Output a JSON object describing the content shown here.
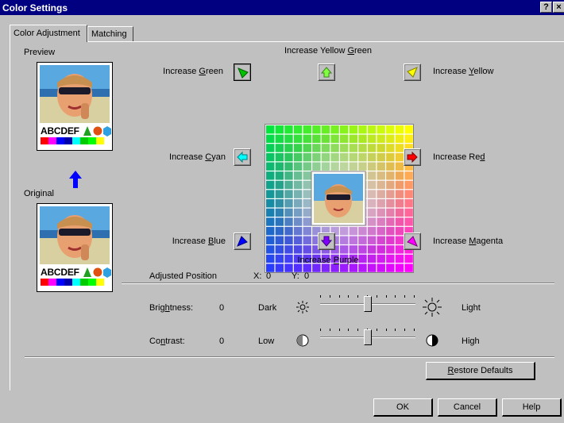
{
  "window": {
    "title": "Color Settings",
    "help_glyph": "?",
    "close_glyph": "×"
  },
  "tabs": [
    {
      "label": "Color Adjustment",
      "active": true
    },
    {
      "label": "Matching",
      "active": false
    }
  ],
  "preview": {
    "label": "Preview",
    "sample_text": "ABCDEF"
  },
  "original": {
    "label": "Original",
    "sample_text": "ABCDEF"
  },
  "swatch_colors": [
    "#ff0000",
    "#ff00ff",
    "#0000ff",
    "#0000aa",
    "#00ffff",
    "#00cc00",
    "#00ff00",
    "#ffff00"
  ],
  "color_buttons": {
    "increase_green": {
      "label": "Increase Green",
      "color": "#00c000"
    },
    "increase_yellow_green": {
      "label": "Increase Yellow Green",
      "color": "#80ff40"
    },
    "increase_yellow": {
      "label": "Increase Yellow",
      "color": "#ffff00"
    },
    "increase_cyan": {
      "label": "Increase Cyan",
      "color": "#00ffff"
    },
    "increase_red": {
      "label": "Increase Red",
      "color": "#ff0000"
    },
    "increase_blue": {
      "label": "Increase Blue",
      "color": "#0000ff"
    },
    "increase_purple": {
      "label": "Increase Purple",
      "color": "#8000ff"
    },
    "increase_magenta": {
      "label": "Increase Magenta",
      "color": "#ff00ff"
    }
  },
  "adjusted_position": {
    "label": "Adjusted Position",
    "x_label": "X:",
    "x_value": "0",
    "y_label": "Y:",
    "y_value": "0"
  },
  "brightness": {
    "label": "Brightness:",
    "value": "0",
    "low_label": "Dark",
    "high_label": "Light",
    "level": 0.5
  },
  "contrast": {
    "label": "Contrast:",
    "value": "0",
    "low_label": "Low",
    "high_label": "High",
    "level": 0.5
  },
  "buttons": {
    "restore_defaults": "Restore Defaults",
    "ok": "OK",
    "cancel": "Cancel",
    "help": "Help"
  }
}
